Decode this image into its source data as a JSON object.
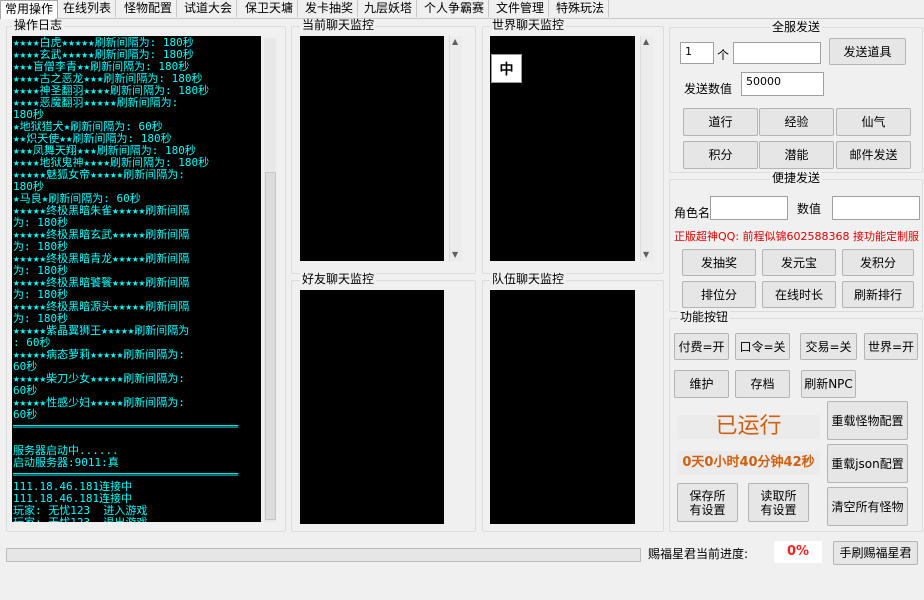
{
  "tabs": [
    "常用操作",
    "在线列表",
    "怪物配置",
    "试道大会",
    "保卫天墉",
    "发卡抽奖",
    "九层妖塔",
    "个人争霸赛",
    "文件管理",
    "特殊玩法"
  ],
  "log_panel": {
    "title": "操作日志",
    "lines": [
      "★★★★白虎★★★★★刷新间隔为: 180秒",
      "★★★★玄武★★★★★刷新间隔为: 180秒",
      "★★★盲僧李青★★刷新间隔为: 180秒",
      "★★★★古之恶龙★★★刷新间隔为: 180秒",
      "★★★★神圣翻羽★★★★刷新间隔为: 180秒",
      "★★★★恶魔翻羽★★★★★刷新间隔为:",
      "180秒",
      "★地狱猎犬★刷新间隔为: 60秒",
      "★★炽天使★★刷新间隔为: 180秒",
      "★★★凤舞天翔★★★刷新间隔为: 180秒",
      "★★★★地狱鬼神★★★★刷新间隔为: 180秒",
      "★★★★★魅狐女帝★★★★★刷新间隔为:",
      "180秒",
      "★马良★刷新间隔为: 60秒",
      "★★★★★终极黑暗朱雀★★★★★刷新间隔",
      "为: 180秒",
      "★★★★★终极黑暗玄武★★★★★刷新间隔",
      "为: 180秒",
      "★★★★★终极黑暗青龙★★★★★刷新间隔",
      "为: 180秒",
      "★★★★★终极黑暗饕餮★★★★★刷新间隔",
      "为: 180秒",
      "★★★★★终极黑暗源头★★★★★刷新间隔",
      "为: 180秒",
      "★★★★★紫晶翼狮王★★★★★刷新间隔为",
      ": 60秒",
      "★★★★★病态萝莉★★★★★刷新间隔为:",
      "60秒",
      "★★★★★柴刀少女★★★★★刷新间隔为:",
      "60秒",
      "★★★★★性感少妇★★★★★刷新间隔为:",
      "60秒",
      "══════════════════════════════════",
      "",
      "服务器启动中......",
      "启动服务器:9011:真",
      "══════════════════════════════════",
      "111.18.46.181连接中",
      "111.18.46.181连接中",
      "玩家: 无忧123  进入游戏",
      "玩家: 无忧123  退出游戏"
    ]
  },
  "chat_panels": {
    "current": "当前聊天监控",
    "world": "世界聊天监控",
    "world_ime_char": "中",
    "friends": "好友聊天监控",
    "team": "队伍聊天监控"
  },
  "server_send": {
    "title": "全服发送",
    "qty_value": "1",
    "qty_unit": "个",
    "item_value": "",
    "send_item_button": "发送道具",
    "send_value_label": "发送数值",
    "send_value": "50000",
    "buttons": [
      "道行",
      "经验",
      "仙气",
      "积分",
      "潜能",
      "邮件发送"
    ]
  },
  "quick_send": {
    "title": "便捷发送",
    "role_label": "角色名",
    "role_value": "",
    "amount_label": "数值",
    "amount_value": "",
    "notice": "正版超神QQ: 前程似锦602588368 接功能定制服",
    "buttons": [
      "发抽奖",
      "发元宝",
      "发积分",
      "排位分",
      "在线时长",
      "刷新排行"
    ]
  },
  "function_buttons": {
    "title": "功能按钮",
    "toggles": [
      "付费=开",
      "口令=关",
      "交易=关",
      "世界=开"
    ],
    "row2": [
      "维护",
      "存档",
      "刷新NPC"
    ],
    "running_status": "已运行",
    "uptime": "0天0小时40分钟42秒",
    "reload_monster": "重载怪物配置",
    "reload_json": "重载json配置",
    "save_all": "保存所有设置",
    "load_all": "读取所有设置",
    "clear_monsters": "清空所有怪物"
  },
  "footer": {
    "progress_label": "赐福星君当前进度:",
    "progress_value": "0%",
    "progress_fraction": 0,
    "manual_button": "手刷赐福星君"
  },
  "colors": {
    "log_text": "#00ffff",
    "notice_red": "#e00000",
    "status_orange": "#d06010",
    "percent_red": "#ff2020"
  }
}
